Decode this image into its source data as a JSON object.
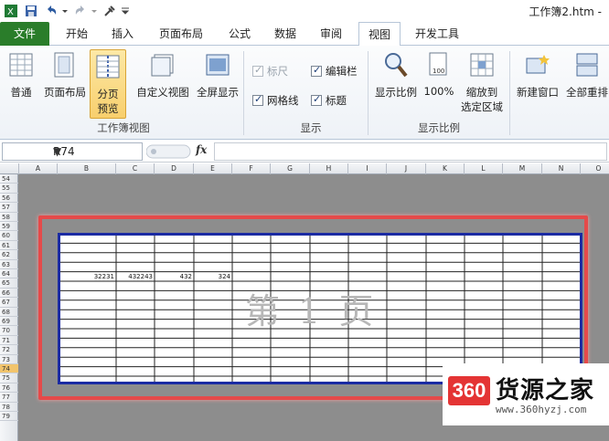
{
  "title": "工作簿2.htm -",
  "tabs": [
    {
      "label": "文件"
    },
    {
      "label": "开始"
    },
    {
      "label": "插入"
    },
    {
      "label": "页面布局"
    },
    {
      "label": "公式"
    },
    {
      "label": "数据"
    },
    {
      "label": "审阅"
    },
    {
      "label": "视图"
    },
    {
      "label": "开发工具"
    }
  ],
  "ribbon": {
    "workbook_views": {
      "normal": "普通",
      "page_layout": "页面布局",
      "page_break_1": "分页",
      "page_break_2": "预览",
      "custom_views": "自定义视图",
      "full_screen": "全屏显示",
      "group_label": "工作簿视图"
    },
    "show": {
      "ruler": "标尺",
      "formula_bar": "编辑栏",
      "gridlines": "网格线",
      "headings": "标题",
      "group_label": "显示"
    },
    "zoom": {
      "zoom": "显示比例",
      "hundred": "100%",
      "zoom_sel_1": "缩放到",
      "zoom_sel_2": "选定区域",
      "group_label": "显示比例"
    },
    "window": {
      "new_window": "新建窗口",
      "arrange_all": "全部重排"
    }
  },
  "formula_bar": {
    "name_box": "R74",
    "fx": "fx"
  },
  "columns": [
    "A",
    "B",
    "C",
    "D",
    "E",
    "F",
    "G",
    "H",
    "I",
    "J",
    "K",
    "L",
    "M",
    "N",
    "O"
  ],
  "rows": [
    "54",
    "55",
    "56",
    "57",
    "58",
    "59",
    "60",
    "61",
    "62",
    "63",
    "64",
    "65",
    "66",
    "67",
    "68",
    "69",
    "70",
    "71",
    "72",
    "73",
    "74",
    "75",
    "76",
    "77",
    "78",
    "79"
  ],
  "cells": {
    "b64": "32231",
    "c64": "432243",
    "d64": "432",
    "e64": "324"
  },
  "page_watermark": "第 1 页",
  "logo": {
    "badge": "360",
    "name": "货源之家",
    "url": "www.360hyzj.com"
  }
}
